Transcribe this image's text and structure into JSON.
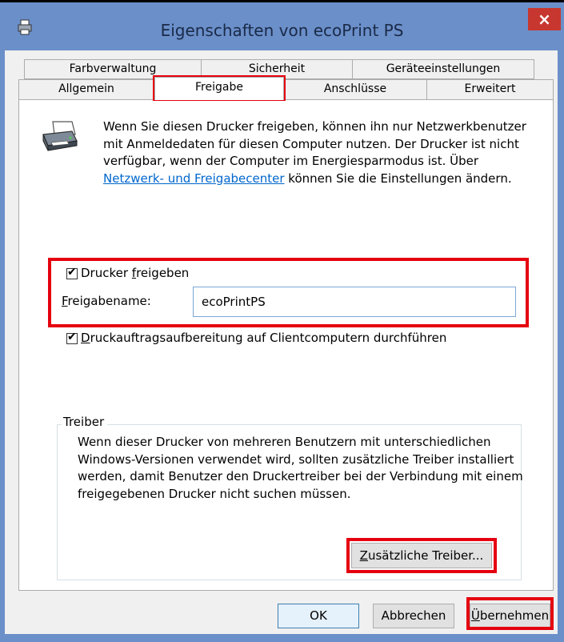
{
  "window": {
    "title": "Eigenschaften von ecoPrint PS",
    "close_label": "×"
  },
  "tabs": {
    "row1": [
      "Farbverwaltung",
      "Sicherheit",
      "Geräteeinstellungen"
    ],
    "row2": [
      "Allgemein",
      "Freigabe",
      "Anschlüsse",
      "Erweitert"
    ],
    "active": "Freigabe"
  },
  "sharing": {
    "description_before_link": "Wenn Sie diesen Drucker freigeben, können ihn nur Netzwerkbenutzer mit Anmeldedaten für diesen Computer nutzen. Der Drucker ist nicht verfügbar, wenn der Computer im Energiesparmodus ist. Über ",
    "description_link": "Netzwerk- und Freigabecenter",
    "description_after_link": " können Sie die Einstellungen ändern.",
    "share_checkbox_label_pre": "Drucker ",
    "share_checkbox_label_accel": "f",
    "share_checkbox_label_post": "reigeben",
    "share_checked": true,
    "share_name_label_accel": "F",
    "share_name_label_post": "reigabename:",
    "share_name_value": "ecoPrintPS",
    "render_checkbox_label_accel": "D",
    "render_checkbox_label_post": "ruckauftragsaufbereitung auf Clientcomputern durchführen",
    "render_checked": true
  },
  "drivers": {
    "legend": "Treiber",
    "text": "Wenn dieser Drucker von mehreren Benutzern mit unterschiedlichen Windows-Versionen verwendet wird, sollten zusätzliche Treiber installiert werden, damit Benutzer den Druckertreiber bei der Verbindung mit einem freigegebenen Drucker nicht suchen müssen.",
    "button_accel": "Z",
    "button_post": "usätzliche Treiber..."
  },
  "footer": {
    "ok_label": "OK",
    "cancel_label": "Abbrechen",
    "apply_accel": "Ü",
    "apply_post": "bernehmen"
  },
  "colors": {
    "titlebar": "#6b8fc9",
    "close": "#c7372f",
    "highlight": "#e5000f",
    "link": "#0066cc"
  },
  "icons": [
    "printer-icon",
    "close-icon",
    "checkbox-icon"
  ]
}
